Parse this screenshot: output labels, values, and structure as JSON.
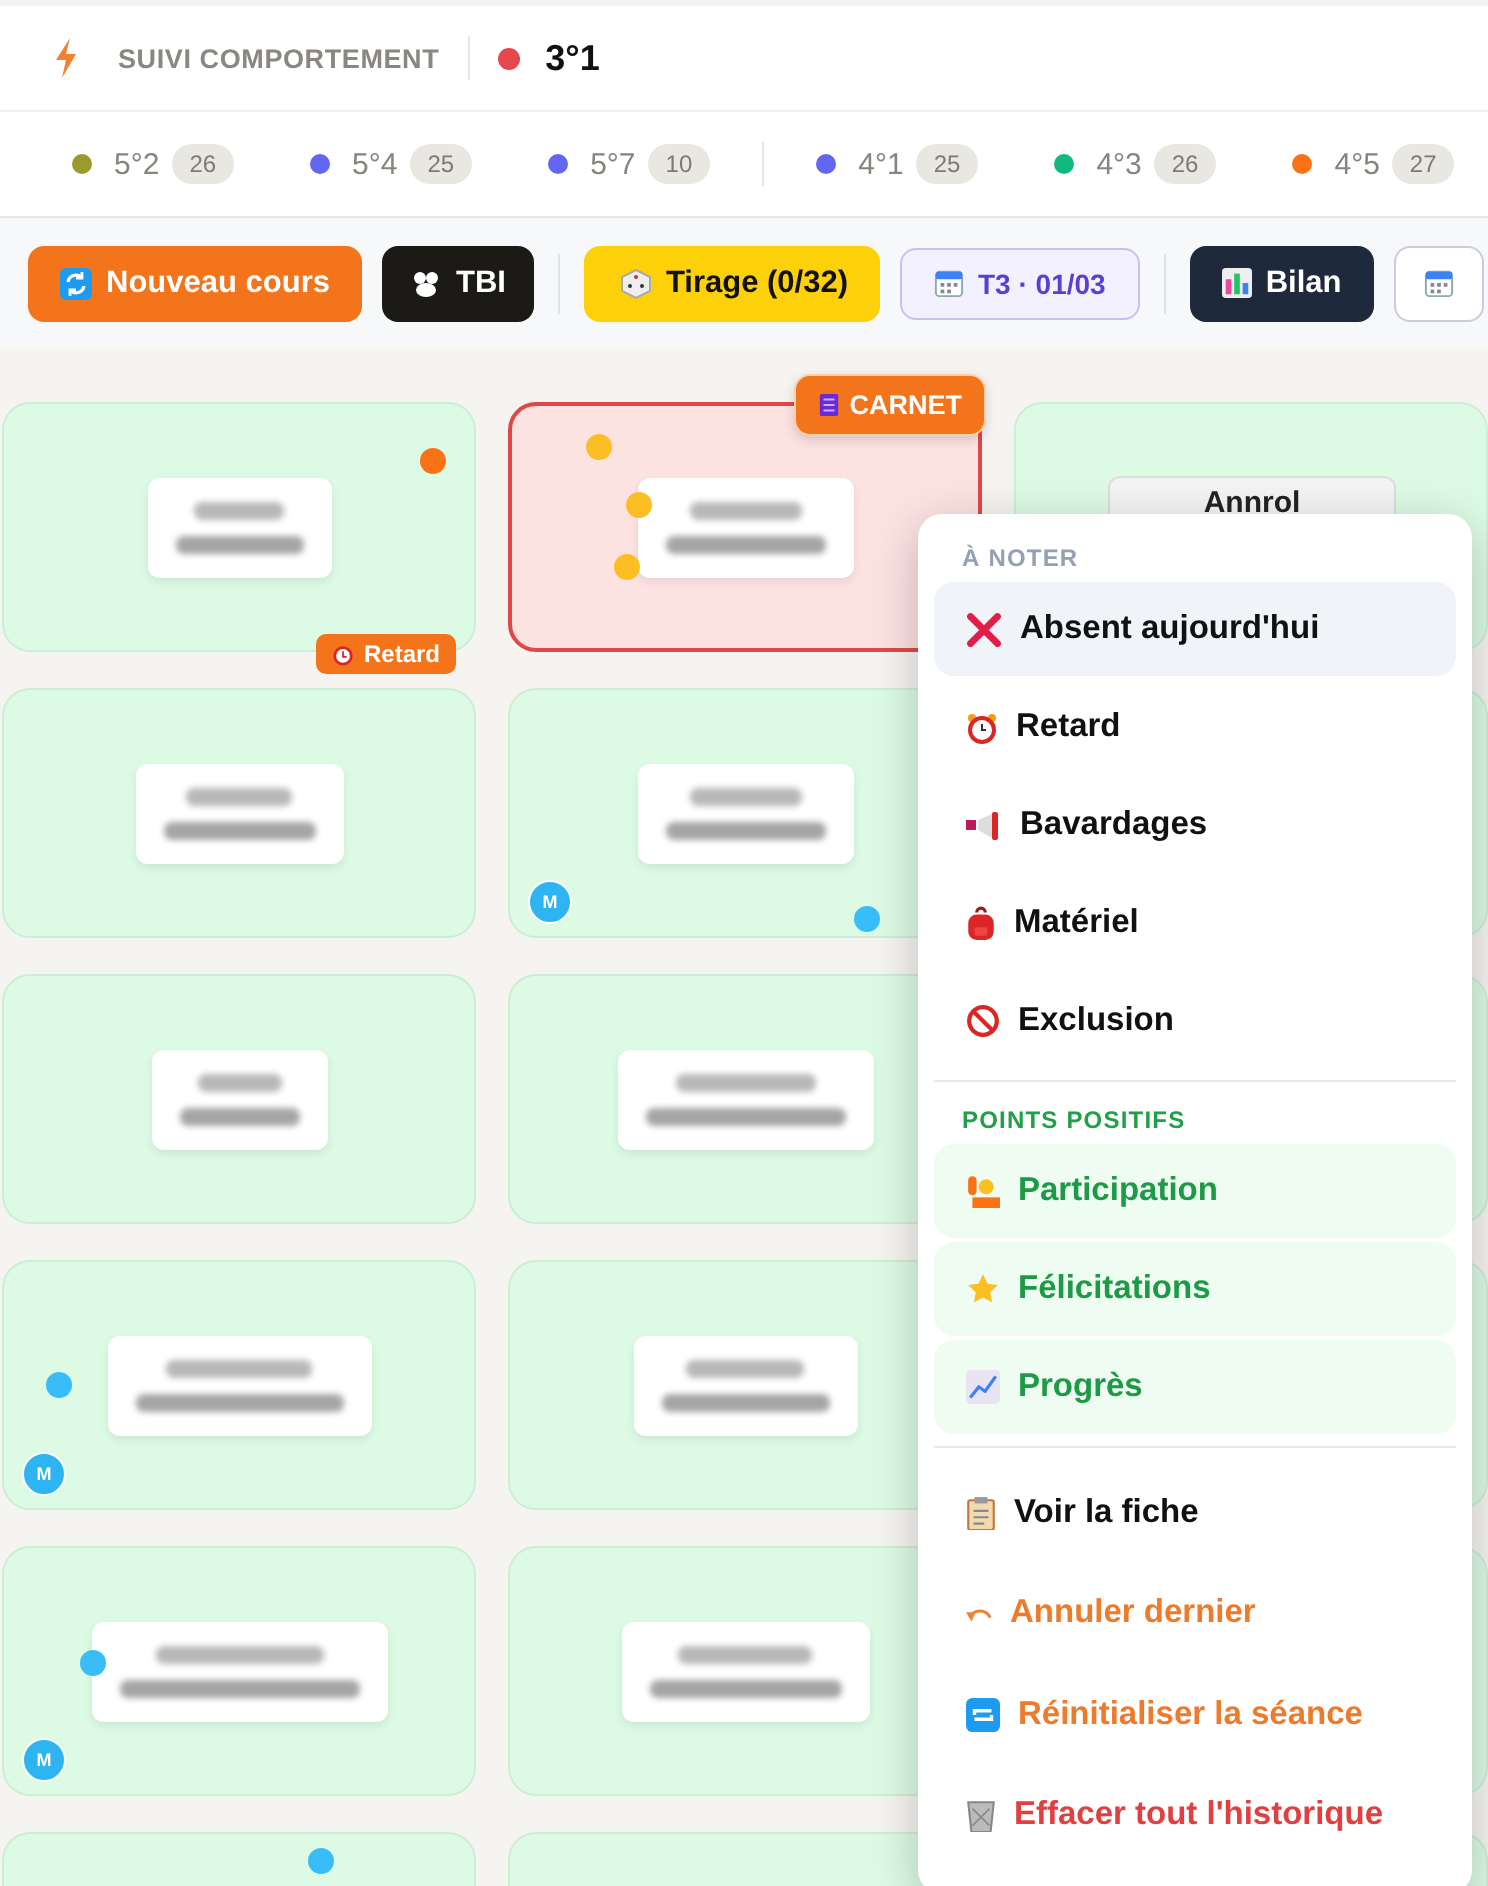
{
  "header": {
    "title": "SUIVI COMPORTEMENT",
    "current_class": {
      "label": "3°1",
      "color": "#e5484d"
    }
  },
  "class_groups": [
    [
      {
        "label": "5°2",
        "count": "26",
        "color": "#9a9a2e"
      },
      {
        "label": "5°4",
        "count": "25",
        "color": "#6366f1"
      },
      {
        "label": "5°7",
        "count": "10",
        "color": "#6366f1"
      }
    ],
    [
      {
        "label": "4°1",
        "count": "25",
        "color": "#6366f1"
      },
      {
        "label": "4°3",
        "count": "26",
        "color": "#10b981"
      },
      {
        "label": "4°5",
        "count": "27",
        "color": "#f97316"
      }
    ]
  ],
  "toolbar": [
    [
      {
        "kind": "refresh",
        "label": "Nouveau cours"
      },
      {
        "kind": "display",
        "label": "TBI"
      }
    ],
    [
      {
        "kind": "dice",
        "label": "Tirage (0/32)"
      },
      {
        "kind": "term",
        "label": "T3 · 01/03"
      }
    ],
    [
      {
        "kind": "chart",
        "label": "Bilan"
      },
      {
        "kind": "calendar"
      }
    ]
  ],
  "seats": [
    {
      "flagged": false,
      "dots": [
        {
          "color": "#f97316"
        }
      ],
      "tag": {
        "kind": "late",
        "label": "Retard"
      }
    },
    {
      "flagged": true,
      "dots": [
        {
          "color": "#fbbf24"
        },
        {
          "color": "#fbbf24"
        },
        {
          "color": "#fbbf24"
        }
      ],
      "tag": {
        "kind": "notebook",
        "label": "CARNET"
      }
    },
    {
      "flagged": false,
      "button": "Annrol"
    },
    {
      "flagged": false
    },
    {
      "flagged": false,
      "badge": "M",
      "dots": [
        {
          "color": "#38bdf8"
        }
      ]
    },
    {
      "flagged": false
    },
    {
      "flagged": false
    },
    {
      "flagged": false
    },
    {
      "flagged": false
    },
    {
      "flagged": false,
      "badge": "M",
      "dots": [
        {
          "color": "#38bdf8"
        }
      ]
    },
    {
      "flagged": false
    },
    {
      "flagged": false
    },
    {
      "flagged": false,
      "badge": "M",
      "dots": [
        {
          "color": "#38bdf8"
        }
      ]
    },
    {
      "flagged": false
    },
    {
      "flagged": false
    },
    {
      "flagged": false,
      "dots": [
        {
          "color": "#38bdf8"
        }
      ]
    },
    {
      "flagged": false
    },
    {
      "flagged": false
    }
  ],
  "menu": {
    "sections": [
      {
        "heading": "À NOTER",
        "kind": "notes",
        "items": [
          {
            "kind": "absent",
            "label": "Absent aujourd'hui",
            "highlighted": true
          },
          {
            "kind": "late",
            "label": "Retard",
            "highlighted": false
          },
          {
            "kind": "talk",
            "label": "Bavardages",
            "highlighted": false
          },
          {
            "kind": "bag",
            "label": "Matériel",
            "highlighted": false
          },
          {
            "kind": "ban",
            "label": "Exclusion",
            "highlighted": false
          }
        ]
      },
      {
        "heading": "POINTS POSITIFS",
        "kind": "positive",
        "items": [
          {
            "kind": "hand",
            "label": "Participation"
          },
          {
            "kind": "star",
            "label": "Félicitations"
          },
          {
            "kind": "progress",
            "label": "Progrès"
          }
        ]
      },
      {
        "kind": "actions",
        "items": [
          {
            "kind": "sheet",
            "label": "Voir la fiche",
            "highlighted": false
          },
          {
            "kind": "undo",
            "label": "Annuler dernier",
            "highlighted": false
          },
          {
            "kind": "reset",
            "label": "Réinitialiser la séance",
            "highlighted": false
          },
          {
            "kind": "trash",
            "label": "Effacer tout l'historique",
            "highlighted": false
          }
        ]
      }
    ]
  }
}
